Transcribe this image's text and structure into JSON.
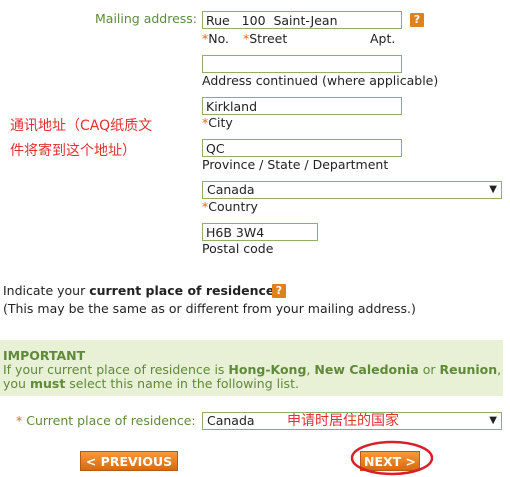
{
  "mailing": {
    "label": "Mailing address:",
    "help_glyph": "?",
    "street_value": "Rue   100  Saint-Jean",
    "star": "*",
    "no_label": "No.",
    "street_label": "Street",
    "apt_label": "Apt.",
    "address2_value": "",
    "address2_label": "Address continued (where applicable)",
    "city_value": "Kirkland",
    "city_label": "City",
    "province_value": "QC",
    "province_label": "Province / State / Department",
    "country_value": "Canada",
    "country_label": "Country",
    "postal_value": "H6B 3W4",
    "postal_label": "Postal code"
  },
  "annotation_left_line1": "通讯地址（CAQ纸质文",
  "annotation_left_line2": "件将寄到这个地址）",
  "residence": {
    "intro_prefix": "Indicate your ",
    "intro_bold": "current place of residence",
    "intro_suffix": ".",
    "help_glyph": "?",
    "note": "(This may be the same as or different from your mailing address.)"
  },
  "important": {
    "title": "IMPORTANT",
    "line1_prefix": "If your current place of residence is ",
    "hk": "Hong-Kong",
    "comma": ", ",
    "nc": "New Caledonia",
    "or": " or ",
    "reunion": "Reunion",
    "line1_suffix": ",",
    "line2_prefix": "you ",
    "must": "must",
    "line2_suffix": " select this name in the following list."
  },
  "current_residence": {
    "star": "*",
    "label": "Current place of residence:",
    "value": "Canada",
    "annotation": "申请时居住的国家"
  },
  "buttons": {
    "previous": "< PREVIOUS",
    "next": "NEXT >"
  },
  "colors": {
    "label_green": "#5f8a3a",
    "button_orange": "#e07a20",
    "annotation_red": "#e03030"
  }
}
